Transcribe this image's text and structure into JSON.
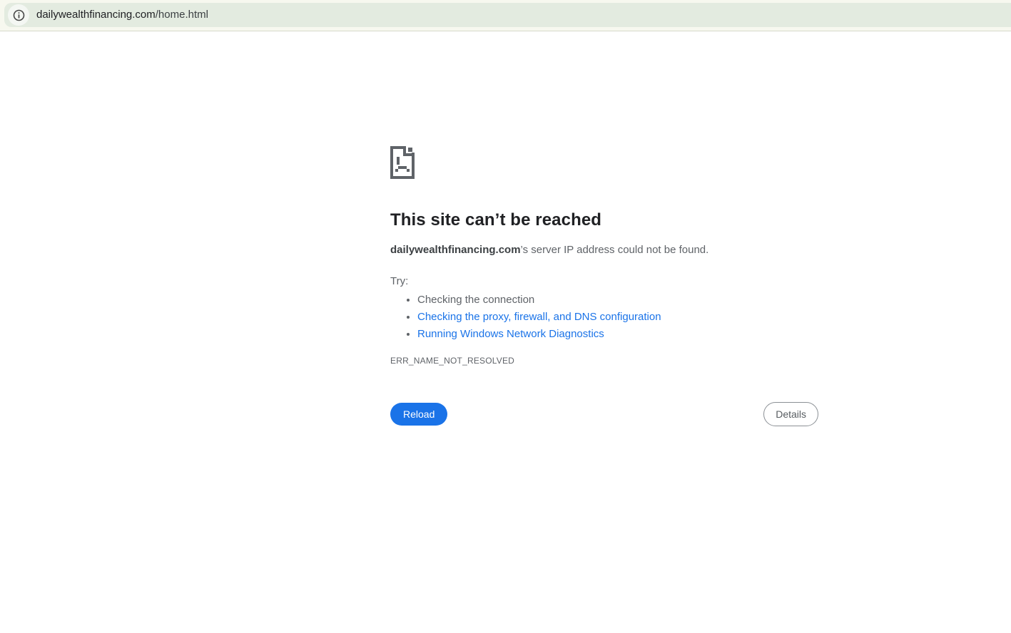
{
  "browser": {
    "omnibox": {
      "url_domain": "dailywealthfinancing.com",
      "url_path": "/home.html",
      "info_icon": "info-icon"
    },
    "colors": {
      "toolbar_bg": "#f7f8ef",
      "omnibox_bg": "#e3ebe0"
    }
  },
  "error_page": {
    "icon": "sad-file-icon",
    "title": "This site can’t be reached",
    "subtitle_domain": "dailywealthfinancing.com",
    "subtitle_rest": "’s server IP address could not be found.",
    "try_label": "Try:",
    "suggestions": [
      {
        "label": "Checking the connection",
        "is_link": false
      },
      {
        "label": "Checking the proxy, firewall, and DNS configuration",
        "is_link": true
      },
      {
        "label": "Running Windows Network Diagnostics",
        "is_link": true
      }
    ],
    "error_code": "ERR_NAME_NOT_RESOLVED",
    "reload_button": "Reload",
    "details_button": "Details",
    "colors": {
      "accent_blue": "#1a73e8",
      "link_blue": "#1a73e8",
      "text_dark": "#202124",
      "text_gray": "#5f6368"
    }
  }
}
